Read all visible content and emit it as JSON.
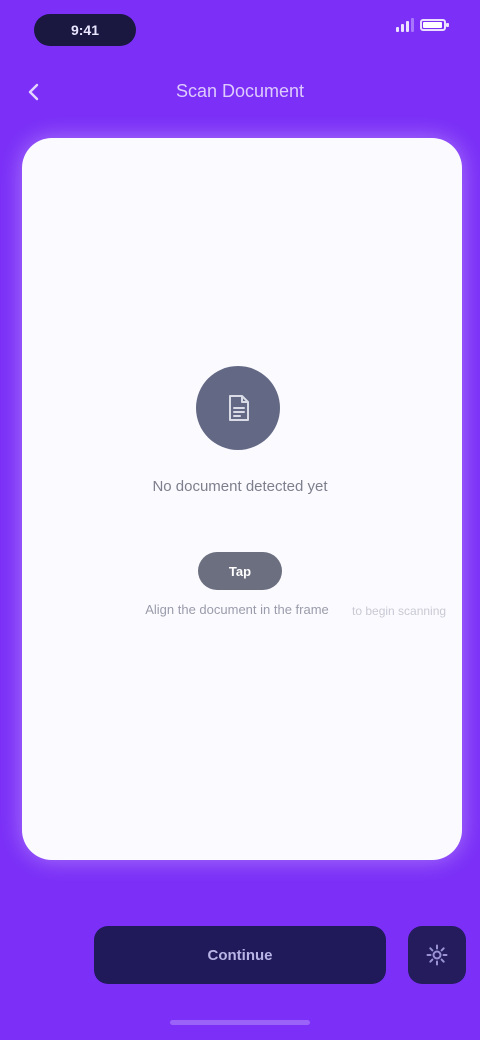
{
  "status_bar": {
    "time": "9:41",
    "signal_level": 0.75,
    "battery_level": 0.85
  },
  "header": {
    "back_icon": "chevron-left-icon",
    "title": "Scan Document"
  },
  "card": {
    "main_icon": "document-icon",
    "message": "No document detected yet",
    "chip_label": "Tap",
    "sub_text": "Align the document in the frame",
    "sub_text_faint": "to begin scanning"
  },
  "bottom_bar": {
    "primary_label": "Continue",
    "secondary_icon": "settings-icon"
  },
  "colors": {
    "background": "#7b2ff7",
    "card": "#fbfaff",
    "button": "#20195a",
    "icon_circle": "#636984"
  }
}
